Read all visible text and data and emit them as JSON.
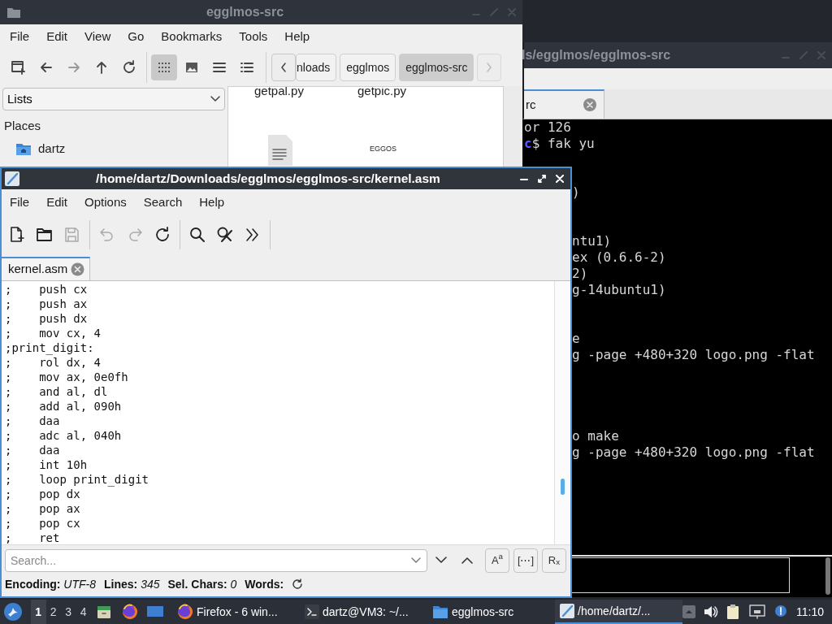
{
  "file_manager": {
    "title": "egglmos-src",
    "menu": [
      "File",
      "Edit",
      "View",
      "Go",
      "Bookmarks",
      "Tools",
      "Help"
    ],
    "toolbar": [
      {
        "kind": "new-tab",
        "selected": false
      },
      {
        "kind": "back",
        "selected": false
      },
      {
        "kind": "forward",
        "selected": false
      },
      {
        "kind": "up",
        "selected": false
      },
      {
        "kind": "reload",
        "selected": false
      },
      {
        "kind": "icons",
        "selected": true
      },
      {
        "kind": "thumbnails",
        "selected": false
      },
      {
        "kind": "compact",
        "selected": false
      },
      {
        "kind": "details",
        "selected": false
      }
    ],
    "breadcrumbs": [
      {
        "label": "nloads",
        "selected": false
      },
      {
        "label": "egglmos",
        "selected": false
      },
      {
        "label": "egglmos-src",
        "selected": true
      }
    ],
    "side_dropdown": "Lists",
    "places_heading": "Places",
    "places": [
      {
        "label": "dartz"
      }
    ],
    "files": [
      {
        "name": "getpal.py"
      },
      {
        "name": "getpic.py"
      }
    ],
    "thumbnail_text": "EGGOS"
  },
  "terminal": {
    "title": "ls/egglmos/egglmos-src",
    "tab": {
      "label": "rc"
    },
    "lines": [
      {
        "text": "or 126"
      },
      {
        "prompt": "c",
        "text": "$ fak yu"
      },
      {
        "text": ")"
      },
      {
        "text": "ntu1)"
      },
      {
        "text": "ex (0.6.6-2)"
      },
      {
        "text": "2)"
      },
      {
        "text": "g-14ubuntu1)"
      },
      {
        "text": "e"
      },
      {
        "text": "g -page +480+320 logo.png -flat"
      },
      {
        "text": "o make"
      },
      {
        "text": "g -page +480+320 logo.png -flat"
      }
    ]
  },
  "editor": {
    "title": "/home/dartz/Downloads/egglmos/egglmos-src/kernel.asm",
    "menu": [
      "File",
      "Edit",
      "Options",
      "Search",
      "Help"
    ],
    "toolbar": [
      {
        "kind": "new",
        "disabled": false
      },
      {
        "kind": "open",
        "disabled": false
      },
      {
        "kind": "save",
        "disabled": true
      },
      {
        "kind": "sep"
      },
      {
        "kind": "undo",
        "disabled": true
      },
      {
        "kind": "redo",
        "disabled": true
      },
      {
        "kind": "reload",
        "disabled": false
      },
      {
        "kind": "sep"
      },
      {
        "kind": "find",
        "disabled": false
      },
      {
        "kind": "replace",
        "disabled": false
      },
      {
        "kind": "more",
        "disabled": false
      },
      {
        "kind": "sep"
      }
    ],
    "tab": {
      "label": "kernel.asm"
    },
    "code": [
      ";    push cx",
      ";    push ax",
      ";    push dx",
      ";    mov cx, 4",
      ";print_digit:",
      ";    rol dx, 4",
      ";    mov ax, 0e0fh",
      ";    and al, dl",
      ";    add al, 090h",
      ";    daa",
      ";    adc al, 040h",
      ";    daa",
      ";    int 10h",
      ";    loop print_digit",
      ";    pop dx",
      ";    pop ax",
      ";    pop cx",
      ";    ret"
    ],
    "search": {
      "placeholder": "Search..."
    },
    "toggles": [
      {
        "label": "A$^{a}$",
        "selected": false
      },
      {
        "label": "[⋯]",
        "selected": false
      },
      {
        "label": "R$_{x}$",
        "selected": false
      }
    ],
    "status": [
      {
        "label": "Encoding:",
        "value": "UTF-8"
      },
      {
        "label": "Lines:",
        "value": "345"
      },
      {
        "label": "Sel. Chars:",
        "value": "0"
      },
      {
        "label": "Words:"
      }
    ]
  },
  "taskbar": {
    "workspaces": [
      {
        "label": "1",
        "selected": true
      },
      {
        "label": "2",
        "selected": false
      },
      {
        "label": "3",
        "selected": false
      },
      {
        "label": "4",
        "selected": false
      }
    ],
    "tasks": [
      {
        "kind": "firefox",
        "label": "Firefox - 6 win...",
        "selected": false
      },
      {
        "kind": "terminal",
        "label": "dartz@VM3: ~/...",
        "selected": false
      },
      {
        "kind": "folder",
        "label": "egglmos-src",
        "selected": false
      },
      {
        "kind": "editor",
        "label": "/home/dartz/...",
        "selected": true
      }
    ],
    "clock": "11:10"
  }
}
